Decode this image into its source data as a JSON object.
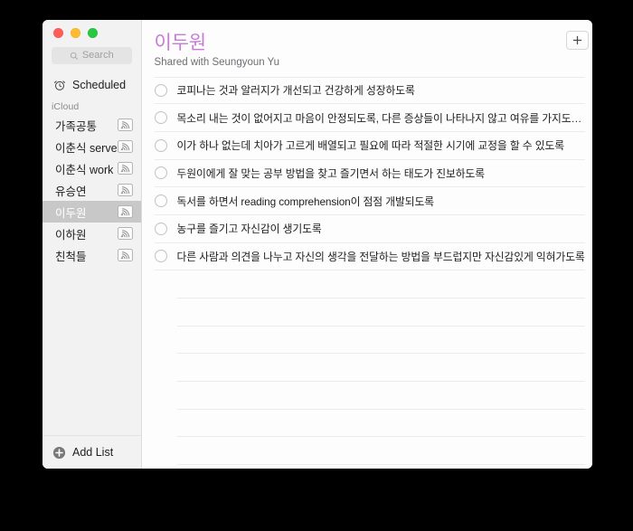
{
  "window": {
    "traffic_lights": [
      {
        "name": "close",
        "color": "#ff5f57"
      },
      {
        "name": "minimize",
        "color": "#febc2e"
      },
      {
        "name": "zoom",
        "color": "#28c840"
      }
    ]
  },
  "sidebar": {
    "search": {
      "placeholder": "Search",
      "value": "",
      "icon": "search-icon"
    },
    "smart_lists": [
      {
        "label": "Scheduled",
        "icon": "alarm-clock-icon"
      }
    ],
    "group_header": "iCloud",
    "lists": [
      {
        "label": "가족공통",
        "shared": true,
        "selected": false
      },
      {
        "label": "이춘식 serve",
        "shared": true,
        "selected": false
      },
      {
        "label": "이춘식 work",
        "shared": true,
        "selected": false
      },
      {
        "label": "유승연",
        "shared": true,
        "selected": false
      },
      {
        "label": "이두원",
        "shared": true,
        "selected": true
      },
      {
        "label": "이하원",
        "shared": true,
        "selected": false
      },
      {
        "label": "친척들",
        "shared": true,
        "selected": false
      }
    ],
    "add_list_label": "Add List",
    "add_list_icon": "plus-circle-icon"
  },
  "main": {
    "title": "이두원",
    "title_color": "#c87ad6",
    "subtitle": "Shared with Seungyoun Yu",
    "add_button_icon": "plus-icon",
    "reminders": [
      {
        "text": "코피나는 것과 알러지가 개선되고 건강하게 성장하도록",
        "completed": false
      },
      {
        "text": "목소리 내는 것이 없어지고 마음이 안정되도록, 다른 증상들이 나타나지 않고 여유를 가지도…",
        "completed": false
      },
      {
        "text": "이가 하나 없는데 치아가 고르게 배열되고 필요에 따라 적절한 시기에 교정을 할 수 있도록",
        "completed": false
      },
      {
        "text": "두원이에게 잘 맞는 공부 방법을 찾고 즐기면서 하는 태도가 진보하도록",
        "completed": false
      },
      {
        "text": "독서를 하면서 reading comprehension이 점점 개발되도록",
        "completed": false
      },
      {
        "text": "농구를 즐기고 자신감이 생기도록",
        "completed": false
      },
      {
        "text": "다른 사람과 의견을 나누고 자신의 생각을 전달하는 방법을 부드럽지만 자신감있게 익혀가도록",
        "completed": false
      }
    ],
    "empty_row_count": 7
  }
}
